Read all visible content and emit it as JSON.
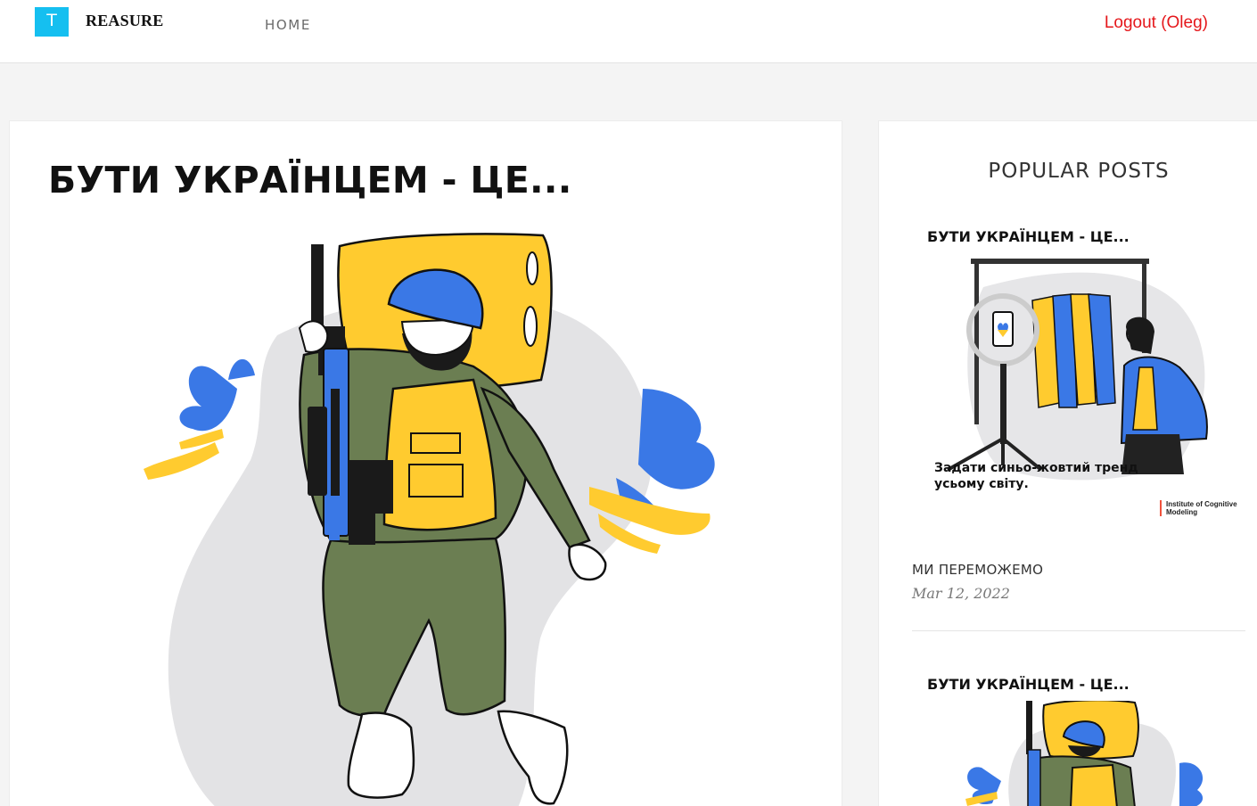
{
  "header": {
    "logo_letter": "T",
    "logo_text": "REASURE",
    "nav_home": "HOME",
    "logout": "Logout (Oleg)"
  },
  "main": {
    "post_image_title": "БУТИ УКРАЇНЦЕМ - ЦЕ..."
  },
  "sidebar": {
    "heading": "POPULAR POSTS",
    "posts": [
      {
        "thumb_title": "БУТИ УКРАЇНЦЕМ - ЦЕ...",
        "thumb_caption": "Задати синьо-жовтий тренд усьому світу.",
        "thumb_credit": "Institute of Cognitive Modeling",
        "title": "МИ ПЕРЕМОЖЕМО",
        "date": "Mar 12, 2022"
      },
      {
        "thumb_title": "БУТИ УКРАЇНЦЕМ - ЦЕ..."
      }
    ]
  },
  "colors": {
    "brand": "#15bff0",
    "logout": "#e5171b",
    "ukraine_blue": "#3a78e6",
    "ukraine_yellow": "#ffcb2f",
    "uniform_green": "#6b7e52"
  }
}
